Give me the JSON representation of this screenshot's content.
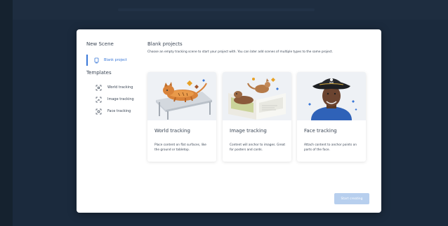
{
  "sidebar": {
    "title": "New Scene",
    "blank_project": {
      "label": "Blank project"
    },
    "templates_heading": "Templates",
    "templates": [
      {
        "label": "World tracking",
        "icon": "world-tracking-icon"
      },
      {
        "label": "Image tracking",
        "icon": "image-tracking-icon"
      },
      {
        "label": "Face tracking",
        "icon": "face-tracking-icon"
      }
    ]
  },
  "main": {
    "title": "Blank projects",
    "description": "Choose an empty tracking scene to start your project with. You can later add scenes of multiple types to the same project.",
    "cards": [
      {
        "title": "World tracking",
        "description": "Place content on flat surfaces, like the ground or tabletop."
      },
      {
        "title": "Image tracking",
        "description": "Content will anchor to images. Great for posters and cards."
      },
      {
        "title": "Face tracking",
        "description": "Attach content to anchor points on parts of the face."
      }
    ]
  },
  "footer": {
    "start_label": "Start creating"
  },
  "colors": {
    "accent": "#3a78d8",
    "button_disabled": "#b7cfee",
    "backdrop": "#1b2a3d"
  }
}
